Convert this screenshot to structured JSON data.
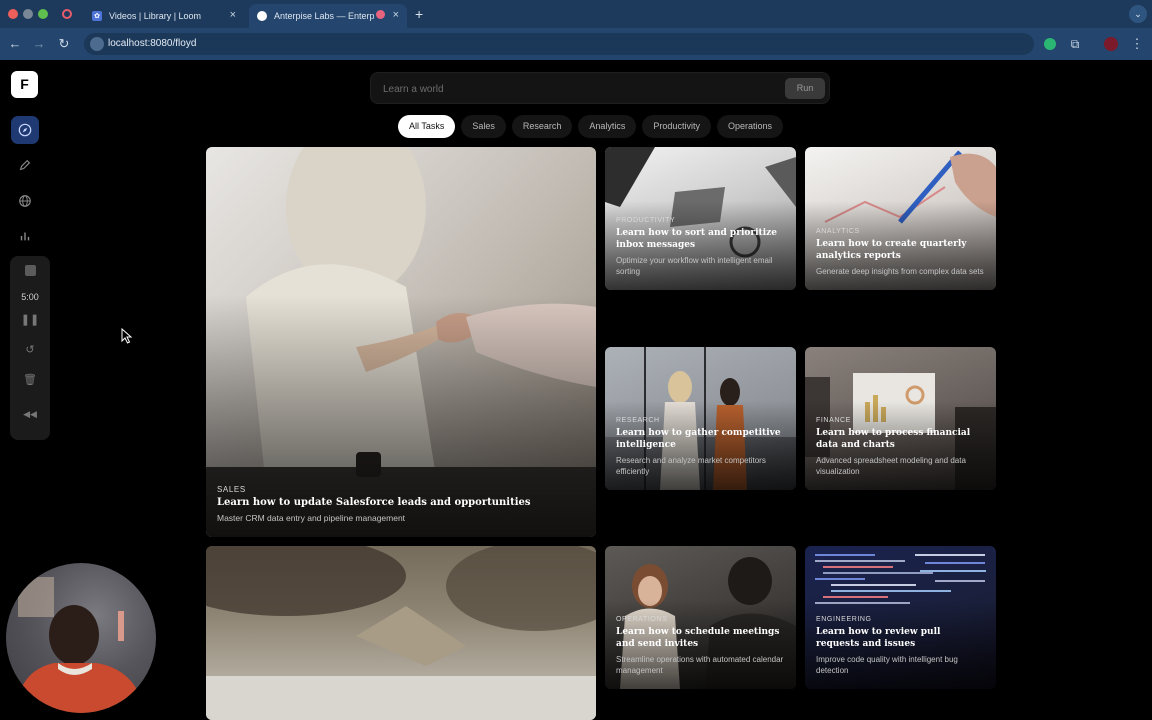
{
  "browser": {
    "tabs": [
      {
        "title": "Videos | Library | Loom"
      },
      {
        "title": "Anterpise Labs — Enterpri"
      }
    ],
    "url": "localhost:8080/floyd"
  },
  "app": {
    "logo": "F",
    "sidebar_icons": [
      "compass-icon",
      "pen-icon",
      "globe-icon",
      "bar-chart-icon"
    ],
    "recorder": {
      "timer": "5:00"
    }
  },
  "search": {
    "placeholder": "Learn a world",
    "run_label": "Run"
  },
  "filters": [
    "All Tasks",
    "Sales",
    "Research",
    "Analytics",
    "Productivity",
    "Operations"
  ],
  "cards": {
    "salesforce": {
      "category": "SALES",
      "title": "Learn how to update Salesforce leads and opportunities",
      "subtitle": "Master CRM data entry and pipeline management"
    },
    "inbox": {
      "category": "PRODUCTIVITY",
      "title": "Learn how to sort and prioritize inbox messages",
      "subtitle": "Optimize your workflow with intelligent email sorting"
    },
    "analytics": {
      "category": "ANALYTICS",
      "title": "Learn how to create quarterly analytics reports",
      "subtitle": "Generate deep insights from complex data sets"
    },
    "research": {
      "category": "RESEARCH",
      "title": "Learn how to gather competitive intelligence",
      "subtitle": "Research and analyze market competitors efficiently"
    },
    "finance": {
      "category": "FINANCE",
      "title": "Learn how to process financial data and charts",
      "subtitle": "Advanced spreadsheet modeling and data visualization"
    },
    "meetings": {
      "category": "OPERATIONS",
      "title": "Learn how to schedule meetings and send invites",
      "subtitle": "Streamline operations with automated calendar management"
    },
    "pullrequests": {
      "category": "ENGINEERING",
      "title": "Learn how to review pull requests and issues",
      "subtitle": "Improve code quality with intelligent bug detection"
    }
  }
}
